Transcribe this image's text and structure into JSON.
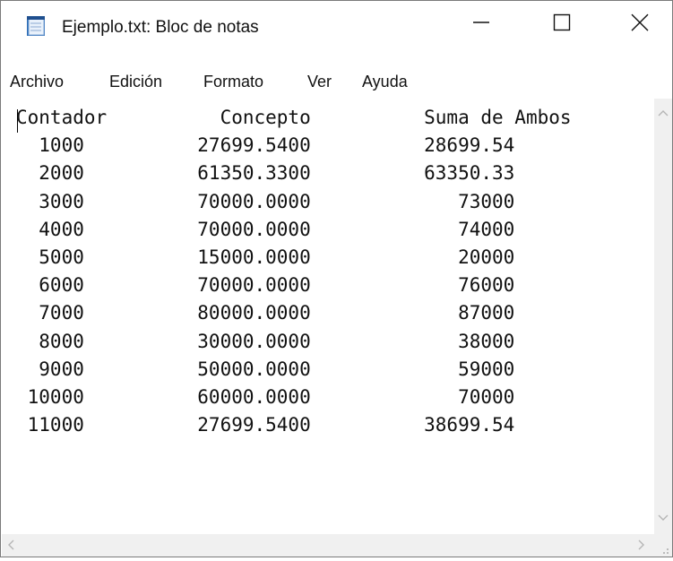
{
  "window": {
    "title": "Ejemplo.txt: Bloc de notas"
  },
  "menu": [
    "Archivo",
    "Edición",
    "Formato",
    "Ver",
    "Ayuda"
  ],
  "document": {
    "lines": [
      "Contador          Concepto          Suma de Ambos",
      "  1000          27699.5400          28699.54",
      "  2000          61350.3300          63350.33",
      "  3000          70000.0000             73000",
      "  4000          70000.0000             74000",
      "  5000          15000.0000             20000",
      "  6000          70000.0000             76000",
      "  7000          80000.0000             87000",
      "  8000          30000.0000             38000",
      "  9000          50000.0000             59000",
      " 10000          60000.0000             70000",
      " 11000          27699.5400          38699.54"
    ]
  }
}
